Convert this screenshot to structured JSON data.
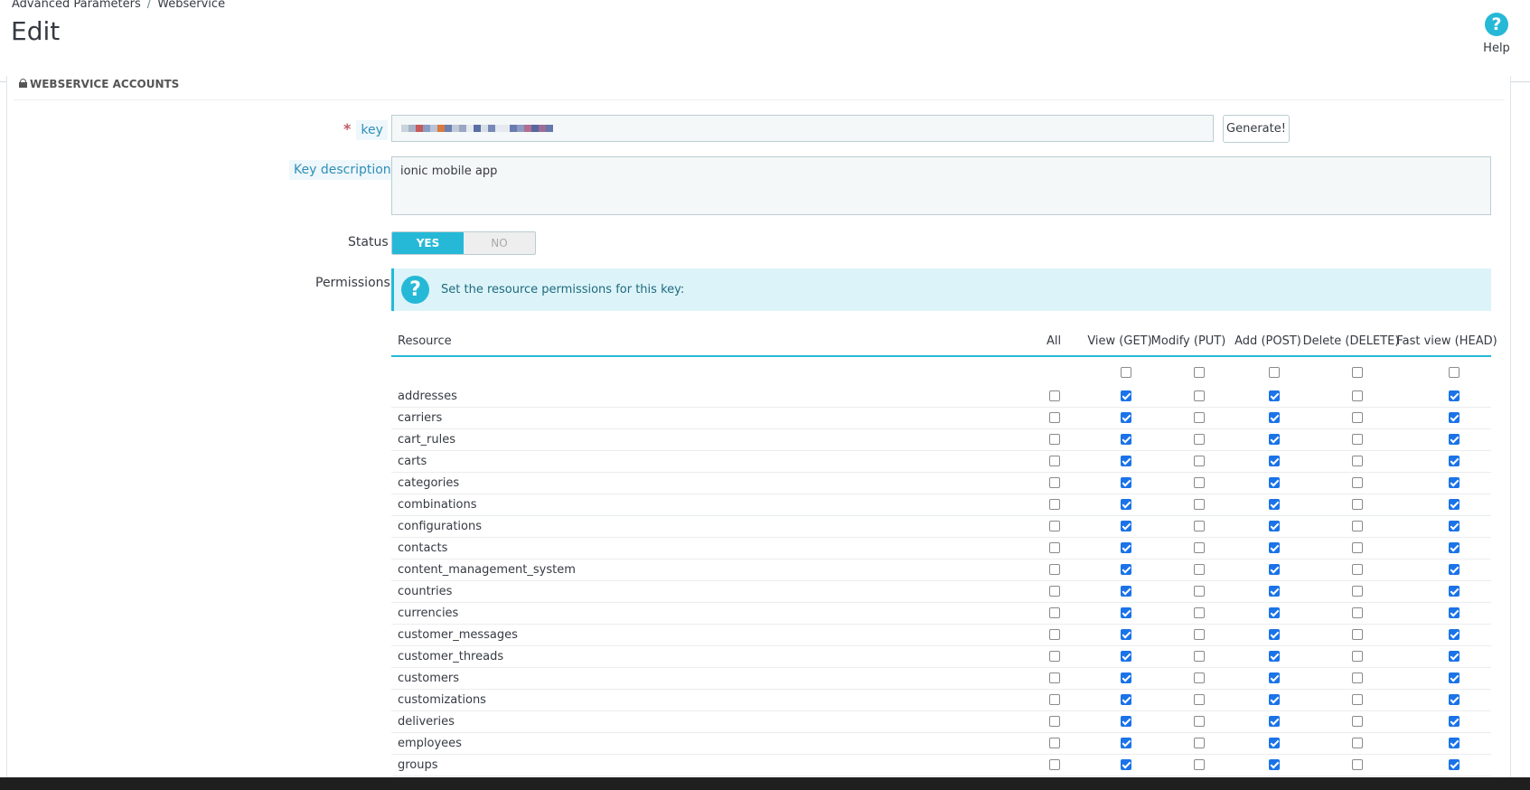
{
  "breadcrumb": {
    "items": [
      "Advanced Parameters",
      "Webservice"
    ],
    "separator": "/"
  },
  "header": {
    "title": "Edit",
    "help_label": "Help"
  },
  "panel": {
    "heading": "WEBSERVICE ACCOUNTS"
  },
  "form": {
    "key_label": "key",
    "key_required_mark": "*",
    "generate_label": "Generate!",
    "key_description_label": "Key description",
    "key_description_value": "ionic mobile app",
    "status_label": "Status",
    "status_yes": "YES",
    "status_no": "NO",
    "status_value": "YES",
    "permissions_label": "Permissions",
    "permissions_hint": "Set the resource permissions for this key:"
  },
  "colors": {
    "accent": "#25b9d7",
    "checkbox_checked": "#1a73e8",
    "hint_bg": "#dcf4f9"
  },
  "table": {
    "columns": [
      "Resource",
      "All",
      "View (GET)",
      "Modify (PUT)",
      "Add (POST)",
      "Delete (DELETE)",
      "Fast view (HEAD)"
    ],
    "header_row_checks": [
      false,
      false,
      false,
      false,
      false
    ],
    "rows": [
      {
        "resource": "addresses",
        "all": false,
        "get": true,
        "put": false,
        "post": true,
        "delete": false,
        "head": true
      },
      {
        "resource": "carriers",
        "all": false,
        "get": true,
        "put": false,
        "post": true,
        "delete": false,
        "head": true
      },
      {
        "resource": "cart_rules",
        "all": false,
        "get": true,
        "put": false,
        "post": true,
        "delete": false,
        "head": true
      },
      {
        "resource": "carts",
        "all": false,
        "get": true,
        "put": false,
        "post": true,
        "delete": false,
        "head": true
      },
      {
        "resource": "categories",
        "all": false,
        "get": true,
        "put": false,
        "post": true,
        "delete": false,
        "head": true
      },
      {
        "resource": "combinations",
        "all": false,
        "get": true,
        "put": false,
        "post": true,
        "delete": false,
        "head": true
      },
      {
        "resource": "configurations",
        "all": false,
        "get": true,
        "put": false,
        "post": true,
        "delete": false,
        "head": true
      },
      {
        "resource": "contacts",
        "all": false,
        "get": true,
        "put": false,
        "post": true,
        "delete": false,
        "head": true
      },
      {
        "resource": "content_management_system",
        "all": false,
        "get": true,
        "put": false,
        "post": true,
        "delete": false,
        "head": true
      },
      {
        "resource": "countries",
        "all": false,
        "get": true,
        "put": false,
        "post": true,
        "delete": false,
        "head": true
      },
      {
        "resource": "currencies",
        "all": false,
        "get": true,
        "put": false,
        "post": true,
        "delete": false,
        "head": true
      },
      {
        "resource": "customer_messages",
        "all": false,
        "get": true,
        "put": false,
        "post": true,
        "delete": false,
        "head": true
      },
      {
        "resource": "customer_threads",
        "all": false,
        "get": true,
        "put": false,
        "post": true,
        "delete": false,
        "head": true
      },
      {
        "resource": "customers",
        "all": false,
        "get": true,
        "put": false,
        "post": true,
        "delete": false,
        "head": true
      },
      {
        "resource": "customizations",
        "all": false,
        "get": true,
        "put": false,
        "post": true,
        "delete": false,
        "head": true
      },
      {
        "resource": "deliveries",
        "all": false,
        "get": true,
        "put": false,
        "post": true,
        "delete": false,
        "head": true
      },
      {
        "resource": "employees",
        "all": false,
        "get": true,
        "put": false,
        "post": true,
        "delete": false,
        "head": true
      },
      {
        "resource": "groups",
        "all": false,
        "get": true,
        "put": false,
        "post": true,
        "delete": false,
        "head": true
      }
    ]
  }
}
